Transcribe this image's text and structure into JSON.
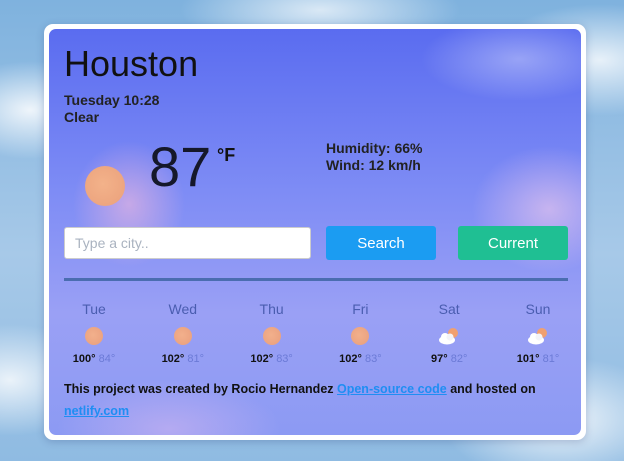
{
  "current": {
    "city": "Houston",
    "datetime": "Tuesday 10:28",
    "condition": "Clear",
    "temperature": "87",
    "unit": "°F",
    "humidity": "Humidity: 66%",
    "wind": "Wind: 12 km/h",
    "icon": "sun-icon"
  },
  "search": {
    "placeholder": "Type a city..",
    "value": "",
    "search_label": "Search",
    "current_label": "Current"
  },
  "forecast": [
    {
      "day": "Tue",
      "icon": "sun-icon",
      "max": "100°",
      "min": "84°"
    },
    {
      "day": "Wed",
      "icon": "sun-icon",
      "max": "102°",
      "min": "81°"
    },
    {
      "day": "Thu",
      "icon": "sun-icon",
      "max": "102°",
      "min": "83°"
    },
    {
      "day": "Fri",
      "icon": "sun-icon",
      "max": "102°",
      "min": "83°"
    },
    {
      "day": "Sat",
      "icon": "cloud-sun-icon",
      "max": "97°",
      "min": "82°"
    },
    {
      "day": "Sun",
      "icon": "cloud-sun-icon",
      "max": "101°",
      "min": "81°"
    }
  ],
  "footer": {
    "text_before": "This project was created by Rocio Hernandez ",
    "source_link": "Open-source code",
    "text_middle": " and hosted on ",
    "host_link": "netlify.com"
  },
  "colors": {
    "search_button": "#1b9cf2",
    "current_button": "#1fbf93",
    "divider": "#4a6db0",
    "link": "#1f8ef3"
  }
}
